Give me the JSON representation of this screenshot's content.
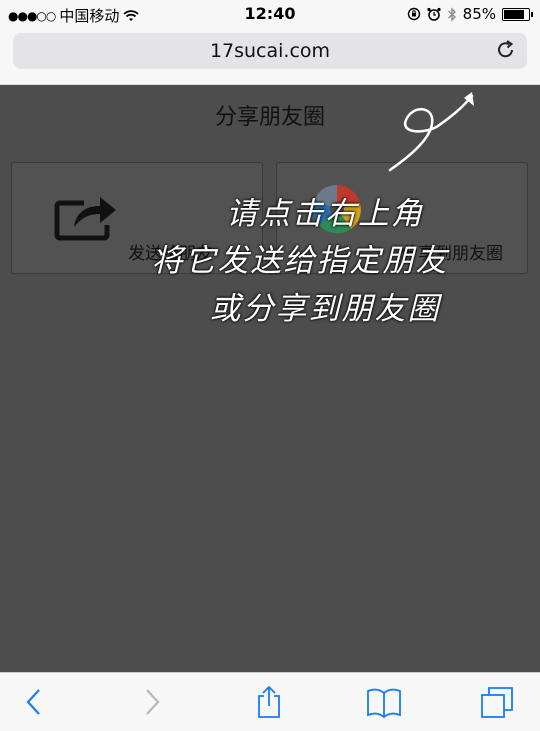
{
  "status_bar": {
    "signal": "●●●○○",
    "carrier": "中国移动",
    "time": "12:40",
    "battery": "85%",
    "battery_level": 0.85
  },
  "address_bar": {
    "url": "17sucai.com"
  },
  "page": {
    "title": "分享朋友圈",
    "share_friend_label": "发送给朋友",
    "share_moments_label": "分享到朋友圈",
    "hint_line1": "请点击右上角",
    "hint_line2": "将它发送给指定朋友",
    "hint_line3": "或分享到朋友圈"
  },
  "toolbar": {
    "icons": [
      "back-icon",
      "forward-icon",
      "share-icon",
      "bookmarks-icon",
      "tabs-icon"
    ]
  }
}
